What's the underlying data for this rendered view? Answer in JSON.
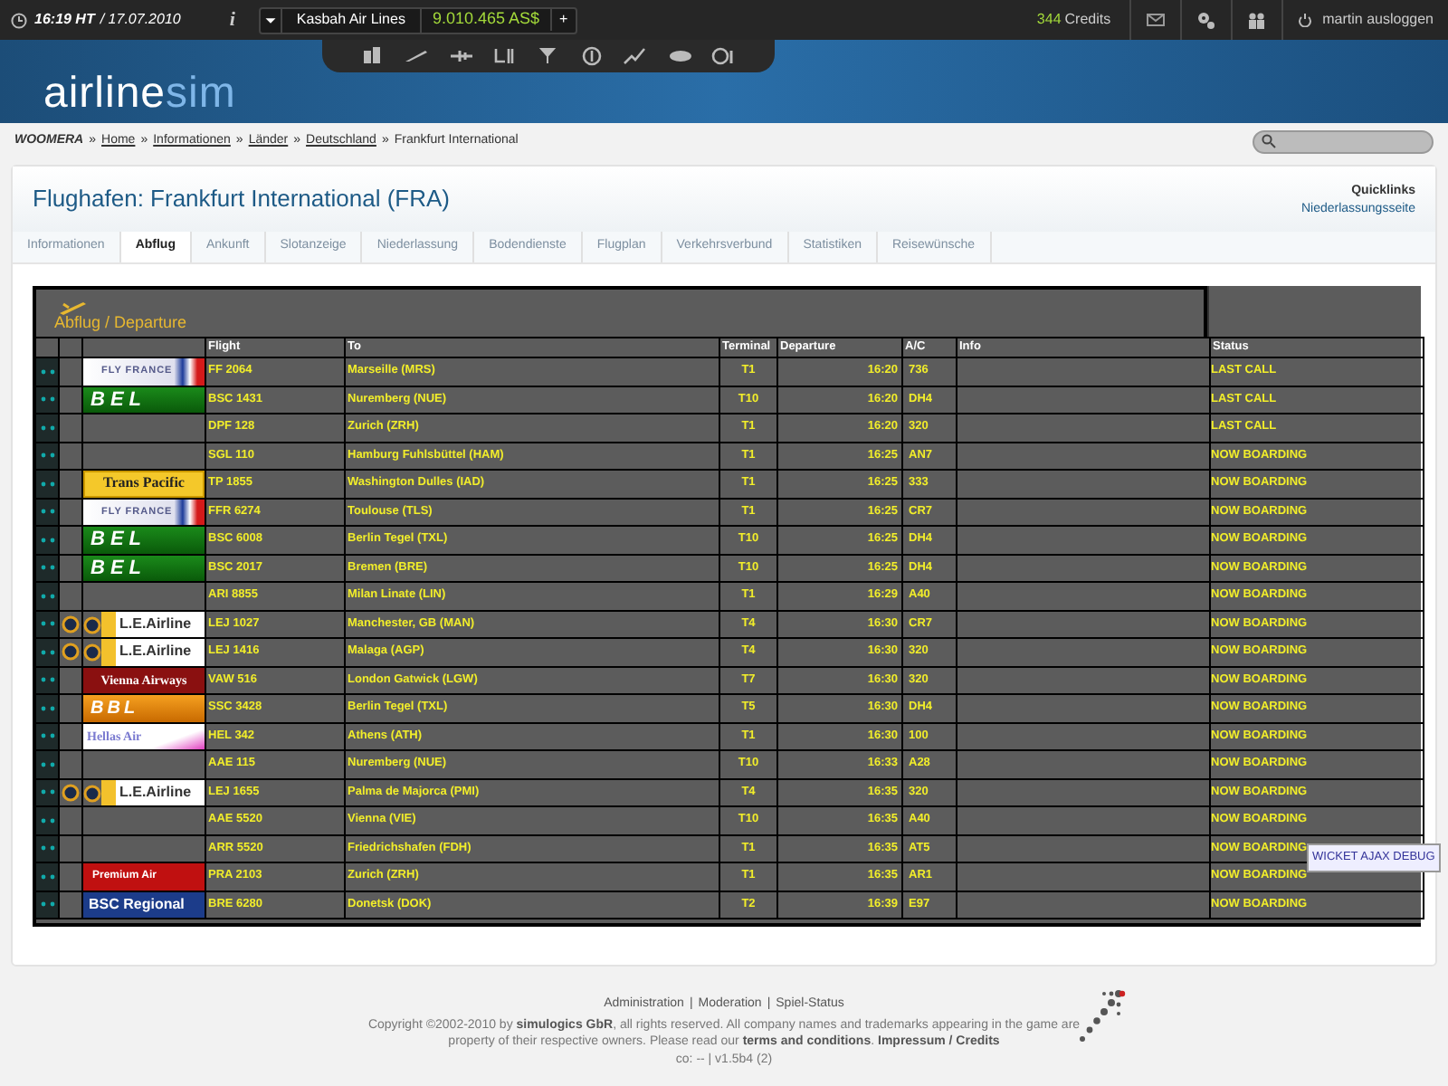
{
  "top_bar": {
    "time": "16:19 HT",
    "date": "/ 17.07.2010",
    "info": "i",
    "airline": "Kasbah Air Lines",
    "balance": "9.010.465 AS$",
    "add": "+",
    "credits_count": "344",
    "credits_label": "Credits",
    "user": "martin ausloggen"
  },
  "logo": {
    "part1": "airline",
    "part2": "sim"
  },
  "breadcrumb": {
    "separator": "»",
    "items": [
      {
        "text": "WOOMERA",
        "kind": "root"
      },
      {
        "text": "Home",
        "kind": "link"
      },
      {
        "text": "Informationen",
        "kind": "link"
      },
      {
        "text": "Länder",
        "kind": "link"
      },
      {
        "text": "Deutschland",
        "kind": "link"
      },
      {
        "text": "Frankfurt International",
        "kind": "current"
      }
    ]
  },
  "page": {
    "title": "Flughafen: Frankfurt International (FRA)",
    "quicklinks_heading": "Quicklinks",
    "quicklink": "Niederlassungsseite"
  },
  "tabs": [
    {
      "label": "Informationen",
      "selected": false
    },
    {
      "label": "Abflug",
      "selected": true
    },
    {
      "label": "Ankunft",
      "selected": false
    },
    {
      "label": "Slotanzeige",
      "selected": false
    },
    {
      "label": "Niederlassung",
      "selected": false
    },
    {
      "label": "Bodendienste",
      "selected": false
    },
    {
      "label": "Flugplan",
      "selected": false
    },
    {
      "label": "Verkehrsverbund",
      "selected": false
    },
    {
      "label": "Statistiken",
      "selected": false
    },
    {
      "label": "Reisewünsche",
      "selected": false
    }
  ],
  "board": {
    "title": "Abflug / Departure",
    "columns": [
      "Flight",
      "To",
      "Terminal",
      "Departure",
      "A/C",
      "Info",
      "Status"
    ],
    "rows": [
      {
        "alliance": false,
        "logo": {
          "kind": "flyfrance",
          "text": "FLY FRANCE"
        },
        "flight": "FF 2064",
        "to": "Marseille (MRS)",
        "terminal": "T1",
        "departure": "16:20",
        "ac": "736",
        "status": "LAST CALL"
      },
      {
        "alliance": false,
        "logo": {
          "kind": "bel",
          "text": "BEL"
        },
        "flight": "BSC 1431",
        "to": "Nuremberg (NUE)",
        "terminal": "T10",
        "departure": "16:20",
        "ac": "DH4",
        "status": "LAST CALL"
      },
      {
        "alliance": false,
        "flight": "DPF 128",
        "to": "Zurich (ZRH)",
        "terminal": "T1",
        "departure": "16:20",
        "ac": "320",
        "status": "LAST CALL"
      },
      {
        "alliance": false,
        "flight": "SGL 110",
        "to": "Hamburg Fuhlsbüttel (HAM)",
        "terminal": "T1",
        "departure": "16:25",
        "ac": "AN7",
        "status": "NOW BOARDING"
      },
      {
        "alliance": false,
        "logo": {
          "kind": "transpacific",
          "text": "Trans Pacific"
        },
        "flight": "TP 1855",
        "to": "Washington Dulles (IAD)",
        "terminal": "T1",
        "departure": "16:25",
        "ac": "333",
        "status": "NOW BOARDING"
      },
      {
        "alliance": false,
        "logo": {
          "kind": "flyfrance",
          "text": "FLY FRANCE"
        },
        "flight": "FFR 6274",
        "to": "Toulouse (TLS)",
        "terminal": "T1",
        "departure": "16:25",
        "ac": "CR7",
        "status": "NOW BOARDING"
      },
      {
        "alliance": false,
        "logo": {
          "kind": "bel",
          "text": "BEL"
        },
        "flight": "BSC 6008",
        "to": "Berlin Tegel (TXL)",
        "terminal": "T10",
        "departure": "16:25",
        "ac": "DH4",
        "status": "NOW BOARDING"
      },
      {
        "alliance": false,
        "logo": {
          "kind": "bel",
          "text": "BEL"
        },
        "flight": "BSC 2017",
        "to": "Bremen (BRE)",
        "terminal": "T10",
        "departure": "16:25",
        "ac": "DH4",
        "status": "NOW BOARDING"
      },
      {
        "alliance": false,
        "flight": "ARI 8855",
        "to": "Milan Linate (LIN)",
        "terminal": "T1",
        "departure": "16:29",
        "ac": "A40",
        "status": "NOW BOARDING"
      },
      {
        "alliance": true,
        "logo": {
          "kind": "le",
          "text": "L.E.Airline"
        },
        "flight": "LEJ 1027",
        "to": "Manchester, GB (MAN)",
        "terminal": "T4",
        "departure": "16:30",
        "ac": "CR7",
        "status": "NOW BOARDING"
      },
      {
        "alliance": true,
        "logo": {
          "kind": "le",
          "text": "L.E.Airline"
        },
        "flight": "LEJ 1416",
        "to": "Malaga (AGP)",
        "terminal": "T4",
        "departure": "16:30",
        "ac": "320",
        "status": "NOW BOARDING"
      },
      {
        "alliance": false,
        "logo": {
          "kind": "vienna",
          "text": "Vienna Airways"
        },
        "flight": "VAW 516",
        "to": "London Gatwick (LGW)",
        "terminal": "T7",
        "departure": "16:30",
        "ac": "320",
        "status": "NOW BOARDING"
      },
      {
        "alliance": false,
        "logo": {
          "kind": "bbl",
          "text": "BBL"
        },
        "flight": "SSC 3428",
        "to": "Berlin Tegel (TXL)",
        "terminal": "T5",
        "departure": "16:30",
        "ac": "DH4",
        "status": "NOW BOARDING"
      },
      {
        "alliance": false,
        "logo": {
          "kind": "hellas",
          "text": "Hellas Air"
        },
        "flight": "HEL 342",
        "to": "Athens (ATH)",
        "terminal": "T1",
        "departure": "16:30",
        "ac": "100",
        "status": "NOW BOARDING"
      },
      {
        "alliance": false,
        "flight": "AAE 115",
        "to": "Nuremberg (NUE)",
        "terminal": "T10",
        "departure": "16:33",
        "ac": "A28",
        "status": "NOW BOARDING"
      },
      {
        "alliance": true,
        "logo": {
          "kind": "le",
          "text": "L.E.Airline"
        },
        "flight": "LEJ 1655",
        "to": "Palma de Majorca (PMI)",
        "terminal": "T4",
        "departure": "16:35",
        "ac": "320",
        "status": "NOW BOARDING"
      },
      {
        "alliance": false,
        "flight": "AAE 5520",
        "to": "Vienna (VIE)",
        "terminal": "T10",
        "departure": "16:35",
        "ac": "A40",
        "status": "NOW BOARDING"
      },
      {
        "alliance": false,
        "flight": "ARR 5520",
        "to": "Friedrichshafen (FDH)",
        "terminal": "T1",
        "departure": "16:35",
        "ac": "AT5",
        "status": "NOW BOARDING"
      },
      {
        "alliance": false,
        "logo": {
          "kind": "premium",
          "text": "Premium Air"
        },
        "flight": "PRA 2103",
        "to": "Zurich (ZRH)",
        "terminal": "T1",
        "departure": "16:35",
        "ac": "AR1",
        "status": "NOW BOARDING"
      },
      {
        "alliance": false,
        "logo": {
          "kind": "bsc",
          "text": "BSC Regional"
        },
        "flight": "BRE 6280",
        "to": "Donetsk (DOK)",
        "terminal": "T2",
        "departure": "16:39",
        "ac": "E97",
        "status": "NOW BOARDING"
      }
    ]
  },
  "debug_button": "WICKET AJAX DEBUG",
  "footer": {
    "links": [
      "Administration",
      "Moderation",
      "Spiel-Status"
    ],
    "separator": "|",
    "copyright": "Copyright ©2002-2010 by **simulogics GbR**, all rights reserved. All company names and trademarks appearing in the game are property of their respective owners. Please read our **terms and conditions**. **Impressum / Credits**",
    "version": "co: -- | v1.5b4 (2)"
  }
}
